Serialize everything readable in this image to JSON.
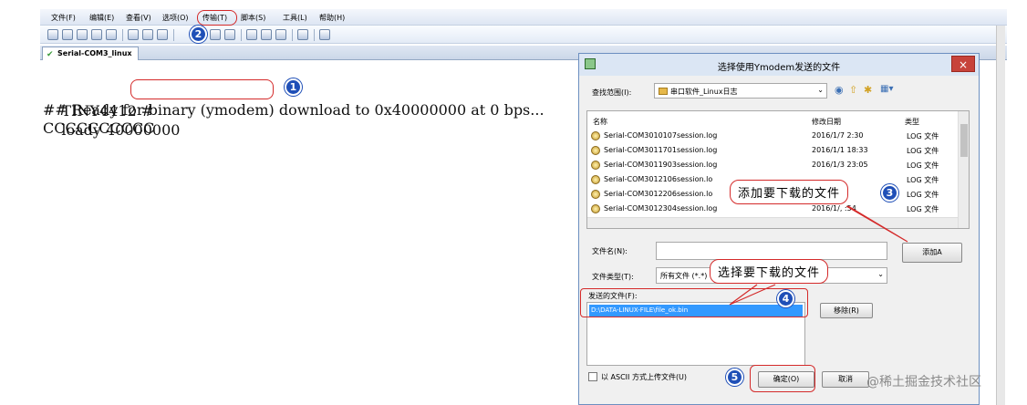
{
  "menu": {
    "items": [
      "文件(F)",
      "编辑(E)",
      "查看(V)",
      "选项(O)",
      "传输(T)",
      "脚本(S)",
      "工具(L)",
      "帮助(H)"
    ]
  },
  "tab": {
    "label": "Serial-COM3_linux"
  },
  "terminal": {
    "prompt": "TINY4412 #",
    "command": "loady 40000000",
    "line2": "## Ready for binary (ymodem) download to 0x40000000 at 0 bps...",
    "line3": "CCCCCCCCCC"
  },
  "dialog": {
    "title": "选择使用Ymodem发送的文件",
    "close": "×",
    "look_in_label": "查找范围(I):",
    "look_in_value": "串口软件_Linux日志",
    "columns": {
      "name": "名称",
      "modified": "修改日期",
      "type": "类型"
    },
    "files": [
      {
        "name": "Serial-COM3010107session.log",
        "modified": "2016/1/7 2:30",
        "type": "LOG 文件"
      },
      {
        "name": "Serial-COM3011701session.log",
        "modified": "2016/1/1 18:33",
        "type": "LOG 文件"
      },
      {
        "name": "Serial-COM3011903session.log",
        "modified": "2016/1/3 23:05",
        "type": "LOG 文件"
      },
      {
        "name": "Serial-COM3012106session.lo",
        "modified": "",
        "type": "LOG 文件"
      },
      {
        "name": "Serial-COM3012206session.lo",
        "modified": "",
        "type": "LOG 文件"
      },
      {
        "name": "Serial-COM3012304session.log",
        "modified": "2016/1/, :54",
        "type": "LOG 文件"
      }
    ],
    "filename_label": "文件名(N):",
    "filename_value": "",
    "filetype_label": "文件类型(T):",
    "filetype_value": "所有文件 (*.*)",
    "add_button": "添加A",
    "send_files_label": "发送的文件(F):",
    "send_files": [
      "D:\\DATA-LINUX-FILE\\file_ok.bin"
    ],
    "remove_button": "移除(R)",
    "ascii_checkbox": "以 ASCII 方式上传文件(U)",
    "ok_button": "确定(O)",
    "cancel_button": "取消"
  },
  "annotations": {
    "callout3": "添加要下载的文件",
    "callout4": "选择要下载的文件",
    "badges": [
      "1",
      "2",
      "3",
      "4",
      "5"
    ]
  },
  "watermark": "@稀土掘金技术社区"
}
